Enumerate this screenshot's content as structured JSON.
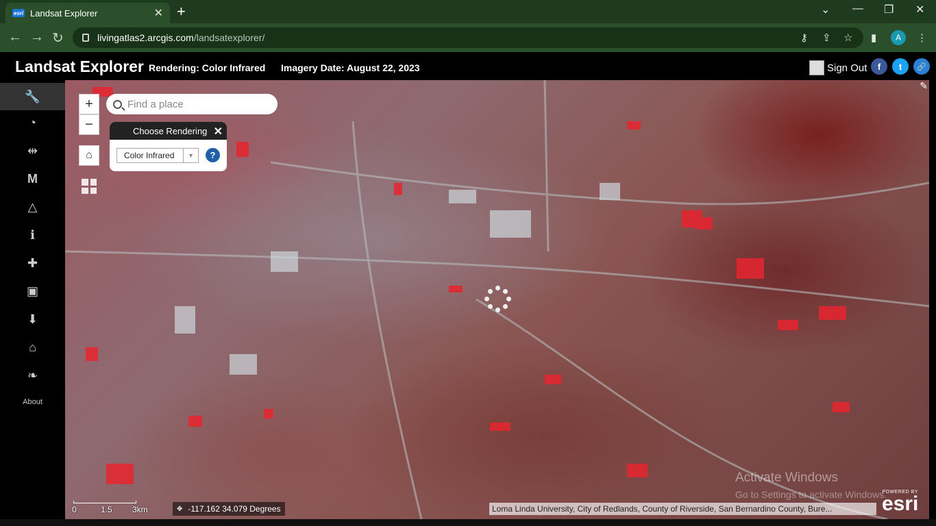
{
  "browser": {
    "tab_title": "Landsat Explorer",
    "tab_favicon": "esri",
    "url_host": "livingatlas2.arcgis.com",
    "url_path": "/landsatexplorer/",
    "profile_initial": "A"
  },
  "header": {
    "title": "Landsat Explorer",
    "rendering": "Rendering: Color Infrared",
    "imagery_date": "Imagery Date: August 22, 2023",
    "sign_out": "Sign Out",
    "social": {
      "facebook": "f",
      "twitter": "t",
      "link": "🔗"
    }
  },
  "sidebar": {
    "items": [
      {
        "icon": "wrench-icon",
        "glyph": "🔧"
      },
      {
        "icon": "clock-icon",
        "glyph": "◔"
      },
      {
        "icon": "swipe-icon",
        "glyph": "⇹"
      },
      {
        "icon": "m-icon",
        "glyph": "M"
      },
      {
        "icon": "triangle-icon",
        "glyph": "△"
      },
      {
        "icon": "info-icon",
        "glyph": "ℹ"
      },
      {
        "icon": "book-plus-icon",
        "glyph": "✚"
      },
      {
        "icon": "save-icon",
        "glyph": "▣"
      },
      {
        "icon": "download-icon",
        "glyph": "⬇"
      },
      {
        "icon": "graduation-cap-icon",
        "glyph": "⌂"
      },
      {
        "icon": "leaf-icon",
        "glyph": "❧"
      }
    ],
    "about_label": "About"
  },
  "map": {
    "search_placeholder": "Find a place",
    "zoom_in": "+",
    "zoom_out": "−",
    "home_glyph": "⌂",
    "rendering_panel": {
      "title": "Choose Rendering",
      "close": "✕",
      "selected": "Color Infrared",
      "help": "?"
    },
    "scale": {
      "labels": [
        "0",
        "1.5",
        "3km"
      ]
    },
    "coordinates": "-117.162 34.079 Degrees",
    "attribution": "Loma Linda University, City of Redlands, County of Riverside, San Bernardino County, Bure...",
    "watermark_line1": "Activate Windows",
    "watermark_line2": "Go to Settings to activate Windows.",
    "esri_powered": "POWERED BY",
    "esri_logo": "esri"
  }
}
